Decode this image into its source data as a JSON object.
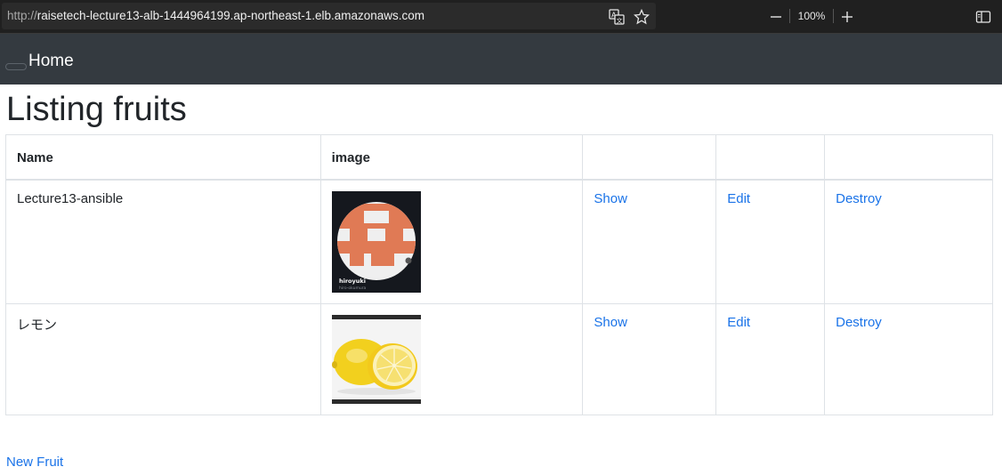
{
  "browser": {
    "url_protocol": "http://",
    "url_rest": "raisetech-lecture13-alb-1444964199.ap-northeast-1.elb.amazonaws.com",
    "zoom_level": "100%",
    "icons": [
      "translate-icon",
      "star-icon",
      "zoom-out-icon",
      "zoom-in-icon",
      "sidebar-icon"
    ]
  },
  "nav": {
    "home_label": "Home"
  },
  "page": {
    "title": "Listing fruits",
    "new_fruit_label": "New Fruit"
  },
  "table": {
    "headers": [
      "Name",
      "image",
      "",
      "",
      ""
    ],
    "rows": [
      {
        "name": "Lecture13-ansible",
        "image_caption": "hiroyuki",
        "image_subcaption": "hiro-okumura",
        "show": "Show",
        "edit": "Edit",
        "destroy": "Destroy"
      },
      {
        "name": "レモン",
        "show": "Show",
        "edit": "Edit",
        "destroy": "Destroy"
      }
    ]
  },
  "colors": {
    "navbar": "#343a40",
    "link": "#1a73e8",
    "avatar_orange": "#e07a55",
    "lemon": "#f2d01e"
  }
}
